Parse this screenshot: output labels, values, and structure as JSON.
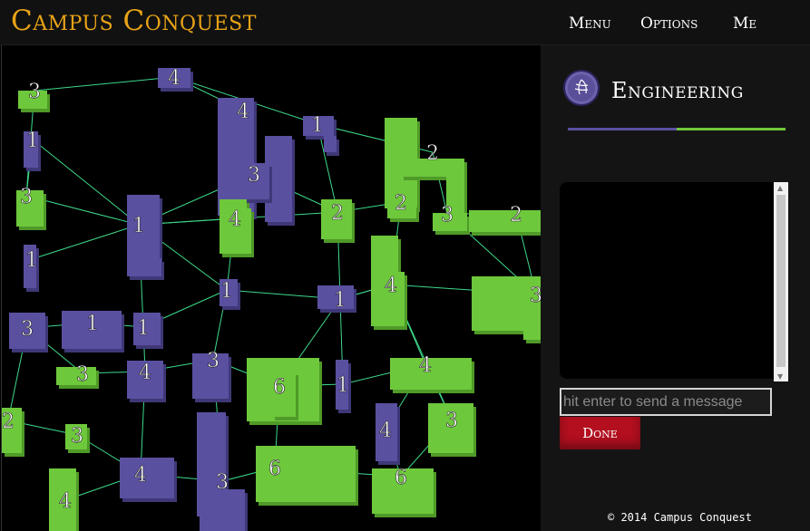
{
  "header": {
    "title": "Campus Conquest",
    "nav": [
      "Menu",
      "Options",
      "Me"
    ]
  },
  "panel": {
    "faction": "Engineering",
    "emblem_icon": "engineering-emblem-icon",
    "chat_placeholder": "hit enter to send a message",
    "done_label": "Done",
    "footer": "© 2014 Campus Conquest"
  },
  "colors": {
    "brand": "#e8a317",
    "purple_team": "#5a50a0",
    "green_team": "#6ec83c",
    "edge": "#3dd98a",
    "done_button": "#b30f1f"
  },
  "map": {
    "territories": [
      {
        "id": "t1",
        "label": "3",
        "team": "green"
      },
      {
        "id": "t2",
        "label": "4",
        "team": "purple"
      },
      {
        "id": "t3",
        "label": "4",
        "team": "purple"
      },
      {
        "id": "t4",
        "label": "1",
        "team": "purple"
      },
      {
        "id": "t5",
        "label": "1",
        "team": "purple"
      },
      {
        "id": "t6",
        "label": "2",
        "team": "green"
      },
      {
        "id": "t7",
        "label": "3",
        "team": "purple"
      },
      {
        "id": "t8",
        "label": "3",
        "team": "green"
      },
      {
        "id": "t9",
        "label": "1",
        "team": "purple"
      },
      {
        "id": "t10",
        "label": "4",
        "team": "green"
      },
      {
        "id": "t11",
        "label": "2",
        "team": "green"
      },
      {
        "id": "t12",
        "label": "2",
        "team": "green"
      },
      {
        "id": "t13",
        "label": "3",
        "team": "green"
      },
      {
        "id": "t14",
        "label": "2",
        "team": "green"
      },
      {
        "id": "t15",
        "label": "1",
        "team": "purple"
      },
      {
        "id": "t16",
        "label": "1",
        "team": "purple"
      },
      {
        "id": "t17",
        "label": "1",
        "team": "purple"
      },
      {
        "id": "t18",
        "label": "4",
        "team": "green"
      },
      {
        "id": "t19",
        "label": "3",
        "team": "green"
      },
      {
        "id": "t20",
        "label": "3",
        "team": "purple"
      },
      {
        "id": "t21",
        "label": "1",
        "team": "purple"
      },
      {
        "id": "t22",
        "label": "1",
        "team": "purple"
      },
      {
        "id": "t23",
        "label": "3",
        "team": "green"
      },
      {
        "id": "t24",
        "label": "4",
        "team": "purple"
      },
      {
        "id": "t25",
        "label": "3",
        "team": "purple"
      },
      {
        "id": "t26",
        "label": "6",
        "team": "green"
      },
      {
        "id": "t27",
        "label": "1",
        "team": "purple"
      },
      {
        "id": "t28",
        "label": "4",
        "team": "green"
      },
      {
        "id": "t29",
        "label": "2",
        "team": "green"
      },
      {
        "id": "t30",
        "label": "3",
        "team": "green"
      },
      {
        "id": "t31",
        "label": "4",
        "team": "purple"
      },
      {
        "id": "t32",
        "label": "3",
        "team": "green"
      },
      {
        "id": "t33",
        "label": "4",
        "team": "purple"
      },
      {
        "id": "t34",
        "label": "6",
        "team": "green"
      },
      {
        "id": "t35",
        "label": "3",
        "team": "purple"
      },
      {
        "id": "t36",
        "label": "6",
        "team": "green"
      },
      {
        "id": "t37",
        "label": "4",
        "team": "green"
      }
    ],
    "links": [
      [
        "t1",
        "t2"
      ],
      [
        "t2",
        "t3"
      ],
      [
        "t2",
        "t4"
      ],
      [
        "t3",
        "t7"
      ],
      [
        "t4",
        "t6"
      ],
      [
        "t4",
        "t11"
      ],
      [
        "t6",
        "t12"
      ],
      [
        "t6",
        "t13"
      ],
      [
        "t12",
        "t11"
      ],
      [
        "t13",
        "t14"
      ],
      [
        "t11",
        "t7"
      ],
      [
        "t11",
        "t16"
      ],
      [
        "t11",
        "t9"
      ],
      [
        "t7",
        "t9"
      ],
      [
        "t7",
        "t10"
      ],
      [
        "t8",
        "t9"
      ],
      [
        "t5",
        "t9"
      ],
      [
        "t9",
        "t15"
      ],
      [
        "t9",
        "t17"
      ],
      [
        "t9",
        "t10"
      ],
      [
        "t10",
        "t15"
      ],
      [
        "t15",
        "t16"
      ],
      [
        "t15",
        "t22"
      ],
      [
        "t16",
        "t18"
      ],
      [
        "t16",
        "t27"
      ],
      [
        "t12",
        "t18"
      ],
      [
        "t13",
        "t19"
      ],
      [
        "t14",
        "t19"
      ],
      [
        "t18",
        "t19"
      ],
      [
        "t18",
        "t16"
      ],
      [
        "t18",
        "t28"
      ],
      [
        "t18",
        "t30"
      ],
      [
        "t16",
        "t26"
      ],
      [
        "t20",
        "t21"
      ],
      [
        "t21",
        "t22"
      ],
      [
        "t22",
        "t24"
      ],
      [
        "t20",
        "t23"
      ],
      [
        "t23",
        "t24"
      ],
      [
        "t24",
        "t25"
      ],
      [
        "t25",
        "t15"
      ],
      [
        "t25",
        "t26"
      ],
      [
        "t26",
        "t27"
      ],
      [
        "t27",
        "t28"
      ],
      [
        "t28",
        "t31"
      ],
      [
        "t28",
        "t30"
      ],
      [
        "t31",
        "t36"
      ],
      [
        "t30",
        "t36"
      ],
      [
        "t26",
        "t34"
      ],
      [
        "t34",
        "t36"
      ],
      [
        "t24",
        "t33"
      ],
      [
        "t33",
        "t35"
      ],
      [
        "t35",
        "t34"
      ],
      [
        "t32",
        "t33"
      ],
      [
        "t29",
        "t32"
      ],
      [
        "t37",
        "t33"
      ],
      [
        "t35",
        "t25"
      ],
      [
        "t9",
        "t22"
      ],
      [
        "t1",
        "t8"
      ],
      [
        "t8",
        "t5"
      ],
      [
        "t29",
        "t20"
      ]
    ]
  }
}
